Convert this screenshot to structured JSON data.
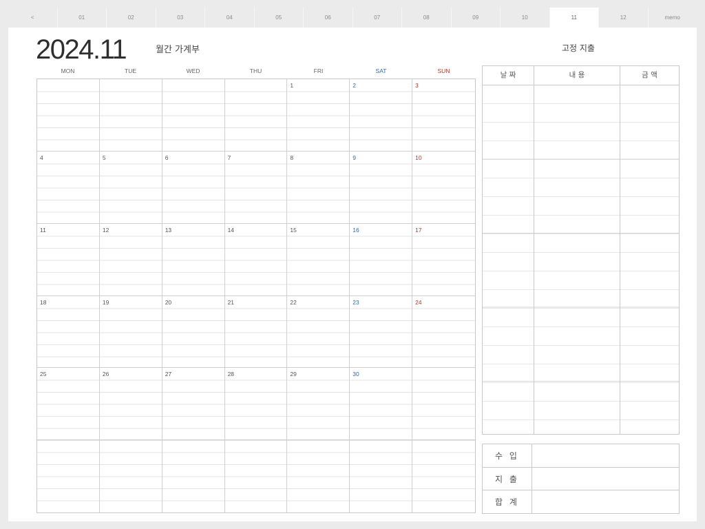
{
  "tabs": [
    "<",
    "01",
    "02",
    "03",
    "04",
    "05",
    "06",
    "07",
    "08",
    "09",
    "10",
    "11",
    "12",
    "memo"
  ],
  "active_tab": "11",
  "header": {
    "year_month": "2024.11",
    "subtitle": "월간 가계부",
    "fixed_expense_title": "고정 지출"
  },
  "calendar": {
    "weekdays": [
      "MON",
      "TUE",
      "WED",
      "THU",
      "FRI",
      "SAT",
      "SUN"
    ],
    "weekday_colors": [
      "#666666",
      "#666666",
      "#666666",
      "#666666",
      "#666666",
      "#2f6aa8",
      "#b03a2e"
    ],
    "days": [
      "",
      "",
      "",
      "",
      "1",
      "2",
      "3",
      "4",
      "5",
      "6",
      "7",
      "8",
      "9",
      "10",
      "11",
      "12",
      "13",
      "14",
      "15",
      "16",
      "17",
      "18",
      "19",
      "20",
      "21",
      "22",
      "23",
      "24",
      "25",
      "26",
      "27",
      "28",
      "29",
      "30",
      "",
      "",
      "",
      "",
      "",
      "",
      "",
      ""
    ]
  },
  "fixed_table": {
    "headers": [
      "날 짜",
      "내 용",
      "금 액"
    ]
  },
  "summary": {
    "rows": [
      "수 입",
      "지 출",
      "합 계"
    ]
  },
  "colors": {
    "saturday": "#2f6aa8",
    "sunday": "#b03a2e"
  }
}
